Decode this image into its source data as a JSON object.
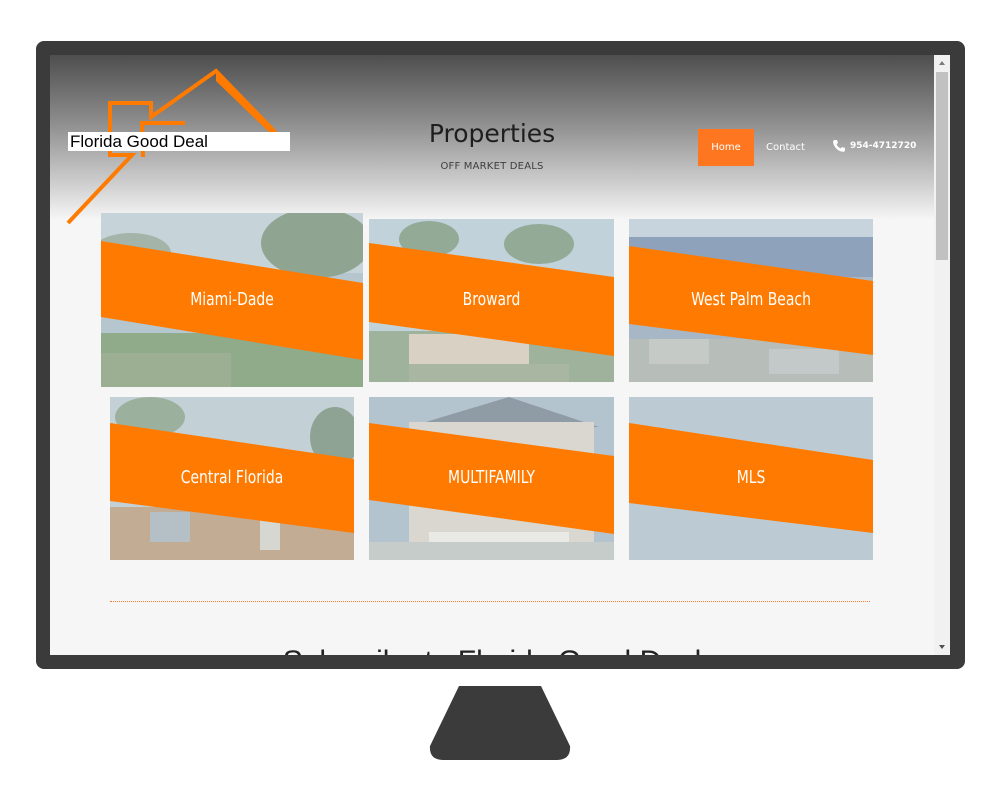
{
  "logo": {
    "text": "Florida Good Deal"
  },
  "header": {
    "title": "Properties",
    "subtitle": "OFF MARKET DEALS"
  },
  "nav": {
    "home": "Home",
    "contact": "Contact",
    "phone": "954-4712720"
  },
  "tiles": [
    {
      "label": "Miami-Dade"
    },
    {
      "label": "Broward"
    },
    {
      "label": "West Palm Beach"
    },
    {
      "label": "Central Florida"
    },
    {
      "label": "MULTIFAMILY"
    },
    {
      "label": "MLS"
    }
  ],
  "footer": {
    "subscribe_heading": "Subscribe to Florida Good Deal"
  },
  "colors": {
    "accent": "#ff7621",
    "monitor": "#3b3b3b",
    "band": "#ff7a00"
  }
}
